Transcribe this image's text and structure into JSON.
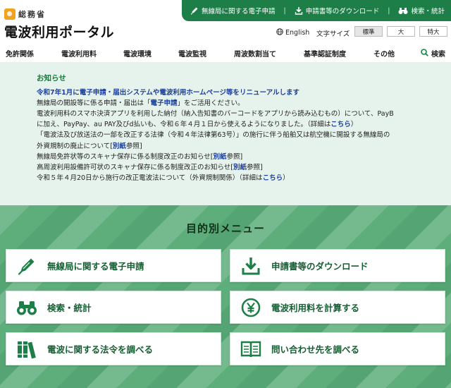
{
  "topbar": {
    "links": [
      {
        "label": "無線局に関する電子申請",
        "icon": "pen-icon"
      },
      {
        "label": "申請書等のダウンロード",
        "icon": "download-icon"
      },
      {
        "label": "検索・統計",
        "icon": "binoculars-icon"
      }
    ],
    "separator": "|"
  },
  "logo": {
    "ministry": "総務省",
    "site_title": "電波利用ポータル"
  },
  "language": {
    "label": "English",
    "icon": "globe-icon"
  },
  "text_size": {
    "label": "文字サイズ",
    "options": [
      "標準",
      "大",
      "特大"
    ],
    "selected": "標準"
  },
  "nav": {
    "items": [
      "免許関係",
      "電波利用料",
      "電波環境",
      "電波監視",
      "周波数割当て",
      "基準認証制度",
      "その他"
    ],
    "search_label": "検索"
  },
  "notice": {
    "title": "お知らせ",
    "lead": "令和7年1月に電子申請・届出システムや電波利用ホームページ等をリニューアルします",
    "line1_pre": "無線局の開設等に係る申請・届出は「",
    "line1_link": "電子申請",
    "line1_post": "」をご活用ください。",
    "line2a": "電波利用料のスマホ決済アプリを利用した納付（納入告知書のバーコードをアプリから読み込むもの）について、PayB",
    "line2b_pre": "に加え、PayPay、au PAY及びd払いも、令和６年４月１日から使えるようになりました。（詳細は",
    "line2b_link": "こちら",
    "line2b_post": "）",
    "line3a": "「電波法及び放送法の一部を改正する法律（令和４年法律第63号）」の施行に伴う船舶又は航空機に開設する無線局の",
    "line3b_pre": "外資規制の廃止について[",
    "line3b_link": "別紙",
    "line3b_post": "参照]",
    "line4_pre": "無線局免許状等のスキャナ保存に係る制度改正のお知らせ[",
    "line4_link": "別紙",
    "line4_post": "参照]",
    "line5_pre": "高周波利用設備許可状のスキャナ保存に係る制度改正のお知らせ[",
    "line5_link": "別紙",
    "line5_post": "参照]",
    "line6_pre": "令和５年４月20日から施行の改正電波法について（外資規制関係）（詳細は",
    "line6_link": "こちら",
    "line6_post": "）"
  },
  "menu": {
    "title": "目的別メニュー",
    "cards": [
      {
        "label": "無線局に関する電子申請",
        "icon": "pen-icon"
      },
      {
        "label": "申請書等のダウンロード",
        "icon": "download-icon"
      },
      {
        "label": "検索・統計",
        "icon": "binoculars-icon"
      },
      {
        "label": "電波利用料を計算する",
        "icon": "yen-icon"
      },
      {
        "label": "電波に関する法令を調べる",
        "icon": "books-icon"
      },
      {
        "label": "問い合わせ先を調べる",
        "icon": "open-book-icon"
      }
    ]
  },
  "colors": {
    "brand_green": "#1d7f47",
    "link_blue": "#1a3f9c",
    "notice_bg": "#e6f2ec",
    "menu_bg": "#5eae7c",
    "logo_orange": "#f2a31b"
  }
}
